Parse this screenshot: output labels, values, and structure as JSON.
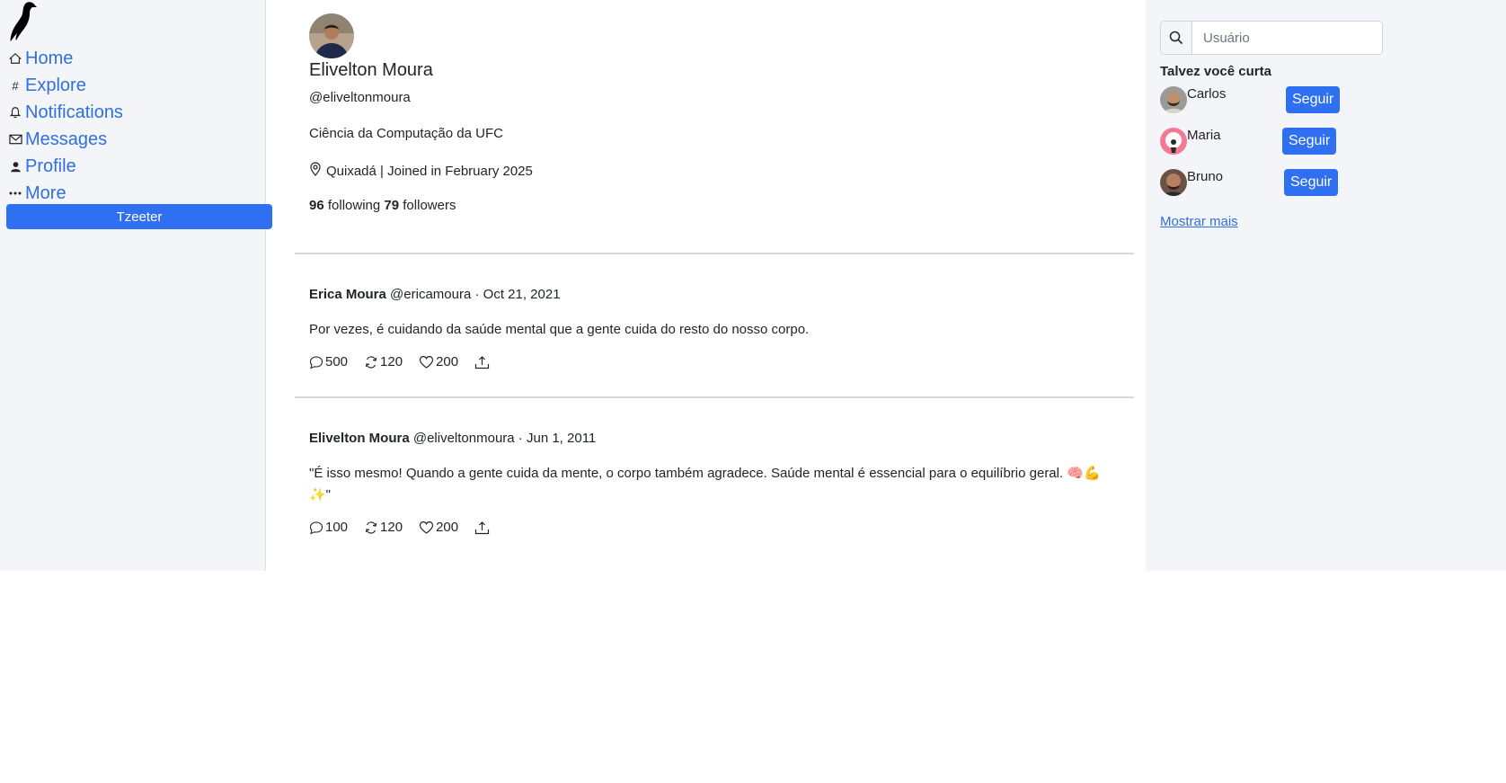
{
  "nav": {
    "items": [
      {
        "label": "Home",
        "icon": "home-icon"
      },
      {
        "label": "Explore",
        "icon": "hash-icon"
      },
      {
        "label": "Notifications",
        "icon": "bell-icon"
      },
      {
        "label": "Messages",
        "icon": "envelope-icon"
      },
      {
        "label": "Profile",
        "icon": "person-icon"
      },
      {
        "label": "More",
        "icon": "more-icon"
      }
    ],
    "tzeeter_label": "Tzeeter"
  },
  "profile": {
    "name": "Elivelton Moura",
    "handle": "@eliveltonmoura",
    "bio": "Ciência da Computação da UFC",
    "location_joined": "Quixadá | Joined in February 2025",
    "following_count": "96",
    "following_label": "following",
    "followers_count": "79",
    "followers_label": "followers"
  },
  "posts": [
    {
      "author": "Erica Moura",
      "handle": "@ericamoura",
      "date": "Oct 21, 2021",
      "text": "Por vezes, é cuidando da saúde mental que a gente cuida do resto do nosso corpo.",
      "replies": "500",
      "retweets": "120",
      "likes": "200"
    },
    {
      "author": "Elivelton Moura",
      "handle": "@eliveltonmoura",
      "date": "Jun 1, 2011",
      "text": "\"É isso mesmo! Quando a gente cuida da mente, o corpo também agradece. Saúde mental é essencial para o equilíbrio geral. 🧠💪✨\"",
      "replies": "100",
      "retweets": "120",
      "likes": "200"
    }
  ],
  "sidebar": {
    "search_placeholder": "Usuário",
    "suggestions_title": "Talvez você curta",
    "suggestions": [
      {
        "name": "Carlos",
        "button": "Seguir"
      },
      {
        "name": "Maria",
        "button": "Seguir"
      },
      {
        "name": "Bruno",
        "button": "Seguir"
      }
    ],
    "show_more": "Mostrar mais"
  },
  "colors": {
    "accent": "#2f6ff2",
    "link": "#2f6fe0",
    "sidebar_bg": "#f4f5f8"
  }
}
